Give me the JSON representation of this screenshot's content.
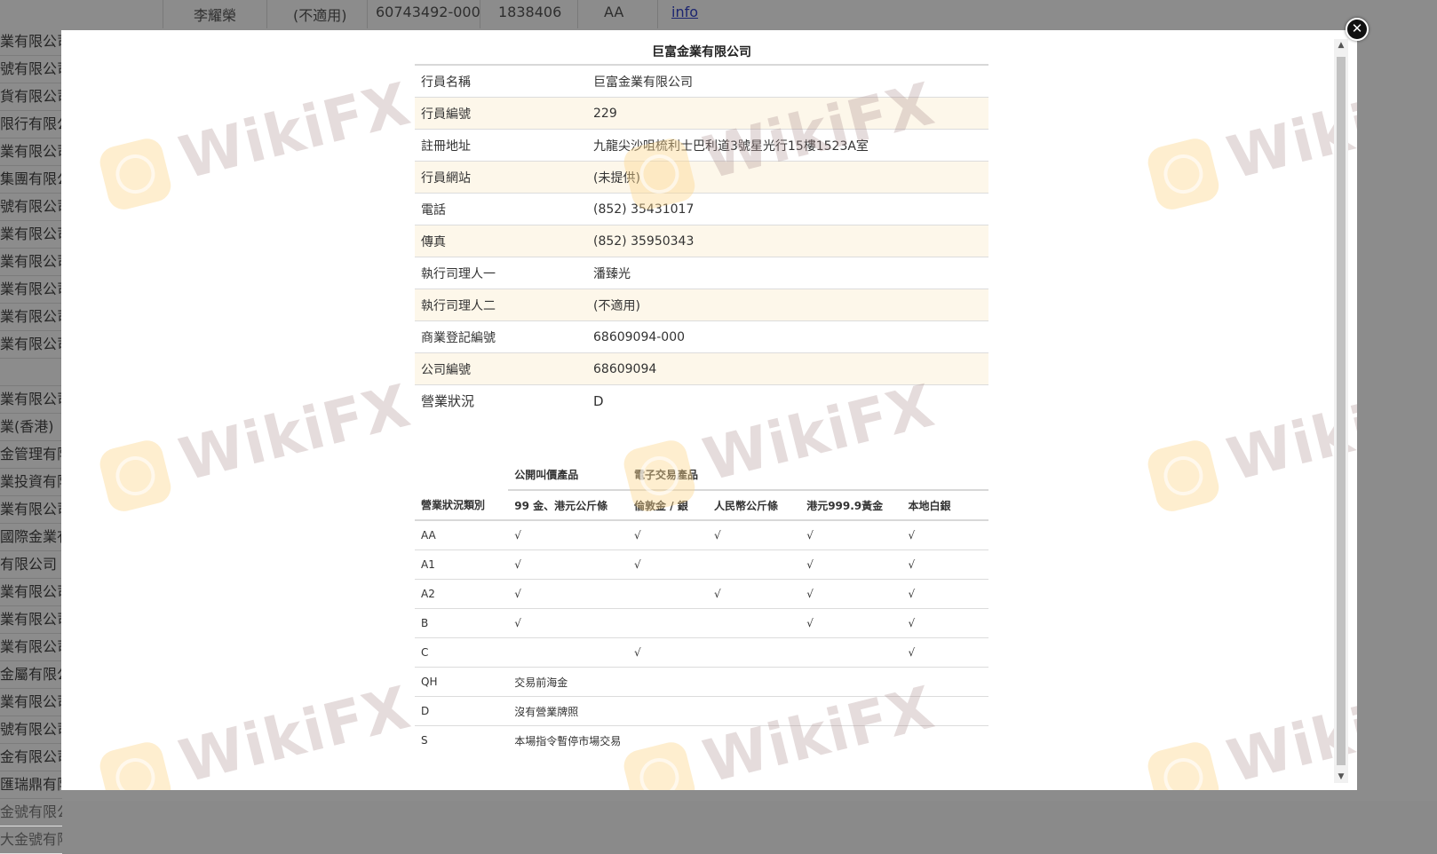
{
  "background": {
    "top_row": [
      "李耀榮",
      "(不適用)",
      "60743492-000",
      "1838406",
      "AA",
      "info"
    ],
    "left_list": [
      "業有限公司",
      "號有限公司",
      "貨有限公司",
      "限行有限公",
      "業有限公司",
      "集團有限公",
      "號有限公司",
      "業有限公司",
      "業有限公司",
      "業有限公司",
      "業有限公司",
      "業有限公司",
      "",
      "業有限公司",
      "業(香港)",
      "金管理有限",
      "業投資有限",
      "業有限公司",
      "國際金業有",
      "有限公司",
      "業有限公司",
      "業有限公司",
      "業有限公司",
      "金屬有限公",
      "業有限公司",
      "號有限公司",
      "金有限公司",
      "匯瑞鼎有限",
      "金號有限公",
      "大金號有限"
    ]
  },
  "modal": {
    "close_label": "✕",
    "title": "巨富金業有限公司",
    "info_rows": [
      {
        "label": "行員名稱",
        "value": "巨富金業有限公司"
      },
      {
        "label": "行員編號",
        "value": "229"
      },
      {
        "label": "註冊地址",
        "value": "九龍尖沙咀梳利士巴利道3號星光行15樓1523A室"
      },
      {
        "label": "行員網站",
        "value": "(未提供)"
      },
      {
        "label": "電話",
        "value": "(852) 35431017"
      },
      {
        "label": "傳真",
        "value": "(852) 35950343"
      },
      {
        "label": "執行司理人一",
        "value": "潘臻光"
      },
      {
        "label": "執行司理人二",
        "value": "(不適用)"
      },
      {
        "label": "商業登記編號",
        "value": "68609094-000"
      },
      {
        "label": "公司編號",
        "value": "68609094"
      },
      {
        "label": "營業狀況",
        "value": "D"
      }
    ],
    "status_table": {
      "group_public": "公開叫價產品",
      "group_electronic": "電子交易產品",
      "headers": [
        "營業狀況類別",
        "99 金、港元公斤條",
        "倫敦金 / 銀",
        "人民幣公斤條",
        "港元999.9黃金",
        "本地白銀"
      ],
      "rows": [
        {
          "code": "AA",
          "cells": [
            "√",
            "√",
            "√",
            "√",
            "√"
          ]
        },
        {
          "code": "A1",
          "cells": [
            "√",
            "√",
            "",
            "√",
            "√"
          ]
        },
        {
          "code": "A2",
          "cells": [
            "√",
            "",
            "√",
            "√",
            "√"
          ]
        },
        {
          "code": "B",
          "cells": [
            "√",
            "",
            "",
            "√",
            "√"
          ]
        },
        {
          "code": "C",
          "cells": [
            "",
            "√",
            "",
            "",
            "√"
          ]
        }
      ],
      "desc_rows": [
        {
          "code": "QH",
          "desc": "交易前海金"
        },
        {
          "code": "D",
          "desc": "沒有營業牌照"
        },
        {
          "code": "S",
          "desc": "本場指令暫停市場交易"
        }
      ]
    }
  },
  "watermark": {
    "text": "WikiFX"
  },
  "colors": {
    "row_alt": "#fdf7ea",
    "link": "#3344cc",
    "overlay": "rgba(0,0,0,0.45)"
  }
}
